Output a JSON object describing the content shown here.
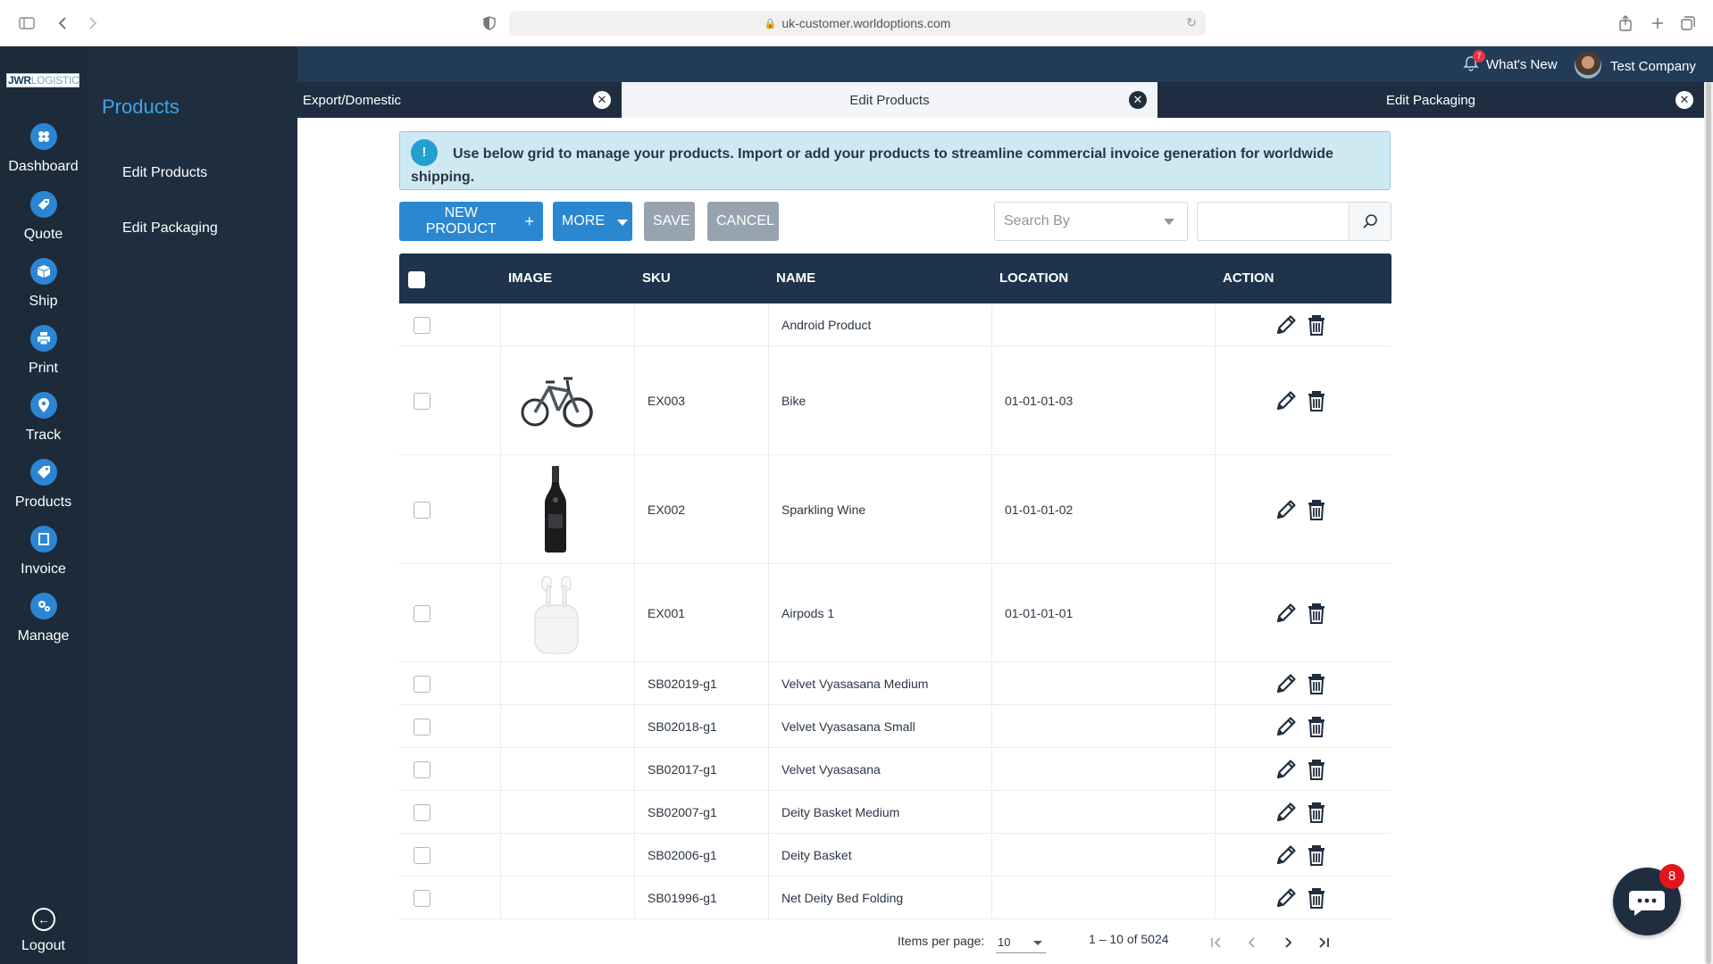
{
  "browser": {
    "url": "uk-customer.worldoptions.com"
  },
  "logo": {
    "text_dark": "JWR",
    "text_light": "LOGISTICS"
  },
  "nav": {
    "items": [
      {
        "label": "Dashboard",
        "icon": "dashboard-icon"
      },
      {
        "label": "Quote",
        "icon": "quote-icon"
      },
      {
        "label": "Ship",
        "icon": "ship-icon"
      },
      {
        "label": "Print",
        "icon": "print-icon"
      },
      {
        "label": "Track",
        "icon": "track-icon"
      },
      {
        "label": "Products",
        "icon": "products-icon"
      },
      {
        "label": "Invoice",
        "icon": "invoice-icon"
      },
      {
        "label": "Manage",
        "icon": "manage-icon"
      }
    ],
    "logout": "Logout"
  },
  "subnav": {
    "title": "Products",
    "items": [
      "Edit Products",
      "Edit Packaging"
    ]
  },
  "header": {
    "notification_count": "7",
    "whats_new": "What's New",
    "company": "Test Company"
  },
  "tabs": [
    {
      "label": "Export/Domestic"
    },
    {
      "label": "Edit Products"
    },
    {
      "label": "Edit Packaging"
    }
  ],
  "banner": {
    "icon": "!",
    "text": "Use below grid to manage your products. Import or add your products to streamline commercial invoice generation for worldwide shipping."
  },
  "toolbar": {
    "new_product": "NEW PRODUCT",
    "more": "MORE",
    "save": "SAVE",
    "cancel": "CANCEL",
    "search_by_placeholder": "Search By",
    "search_value": ""
  },
  "table": {
    "columns": [
      "IMAGE",
      "SKU",
      "NAME",
      "LOCATION",
      "ACTION"
    ],
    "rows": [
      {
        "sku": "",
        "name": "Android Product",
        "location": "",
        "image": ""
      },
      {
        "sku": "EX003",
        "name": "Bike",
        "location": "01-01-01-03",
        "image": "bike"
      },
      {
        "sku": "EX002",
        "name": "Sparkling Wine",
        "location": "01-01-01-02",
        "image": "wine"
      },
      {
        "sku": "EX001",
        "name": "Airpods 1",
        "location": "01-01-01-01",
        "image": "airpods"
      },
      {
        "sku": "SB02019-g1",
        "name": "Velvet Vyasasana Medium",
        "location": "",
        "image": ""
      },
      {
        "sku": "SB02018-g1",
        "name": "Velvet Vyasasana Small",
        "location": "",
        "image": ""
      },
      {
        "sku": "SB02017-g1",
        "name": "Velvet Vyasasana",
        "location": "",
        "image": ""
      },
      {
        "sku": "SB02007-g1",
        "name": "Deity Basket Medium",
        "location": "",
        "image": ""
      },
      {
        "sku": "SB02006-g1",
        "name": "Deity Basket",
        "location": "",
        "image": ""
      },
      {
        "sku": "SB01996-g1",
        "name": "Net Deity Bed Folding",
        "location": "",
        "image": ""
      }
    ]
  },
  "pager": {
    "items_per_page_label": "Items per page:",
    "items_per_page": "10",
    "range": "1 – 10 of 5024"
  },
  "chat": {
    "badge": "8"
  },
  "colors": {
    "sidebar": "#1c2a3a",
    "accent": "#2a87d0",
    "header": "#1f344c"
  }
}
